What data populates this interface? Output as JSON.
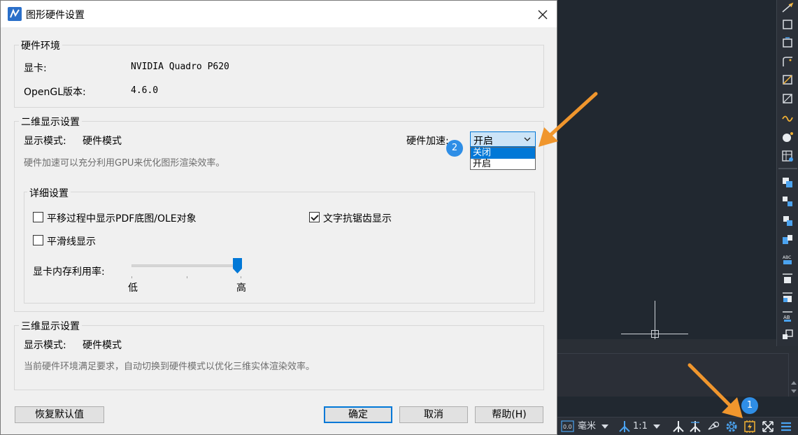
{
  "dialog": {
    "title": "图形硬件设置",
    "hardware_env": {
      "title": "硬件环境",
      "gpu_label": "显卡:",
      "gpu_value": "NVIDIA Quadro P620",
      "opengl_label": "OpenGL版本:",
      "opengl_value": "4.6.0"
    },
    "display_2d": {
      "title": "二维显示设置",
      "mode_label": "显示模式:",
      "mode_value": "硬件模式",
      "hw_accel_label": "硬件加速:",
      "hw_accel_value": "开启",
      "hw_accel_options": [
        "关闭",
        "开启"
      ],
      "hint": "硬件加速可以充分利用GPU来优化图形渲染效率。",
      "details": {
        "title": "详细设置",
        "pan_pdf_label": "平移过程中显示PDF底图/OLE对象",
        "pan_pdf_checked": false,
        "text_aa_label": "文字抗锯齿显示",
        "text_aa_checked": true,
        "smooth_line_label": "平滑线显示",
        "smooth_line_checked": false,
        "vram_label": "显卡内存利用率:",
        "vram_low": "低",
        "vram_high": "高",
        "vram_level": 1.0
      }
    },
    "display_3d": {
      "title": "三维显示设置",
      "mode_label": "显示模式:",
      "mode_value": "硬件模式",
      "hint": "当前硬件环境满足要求，自动切换到硬件模式以优化三维实体渲染效率。"
    },
    "buttons": {
      "restore": "恢复默认值",
      "ok": "确定",
      "cancel": "取消",
      "help": "帮助(H)"
    }
  },
  "statusbar": {
    "scale_icon_text": "0.0",
    "unit": "毫米",
    "scale": "1:1"
  },
  "callouts": {
    "one": "1",
    "two": "2"
  },
  "colors": {
    "accent": "#0078d7",
    "callout_arrow": "#f0962d",
    "badge": "#2f8ee6",
    "cad_background": "#212830"
  }
}
